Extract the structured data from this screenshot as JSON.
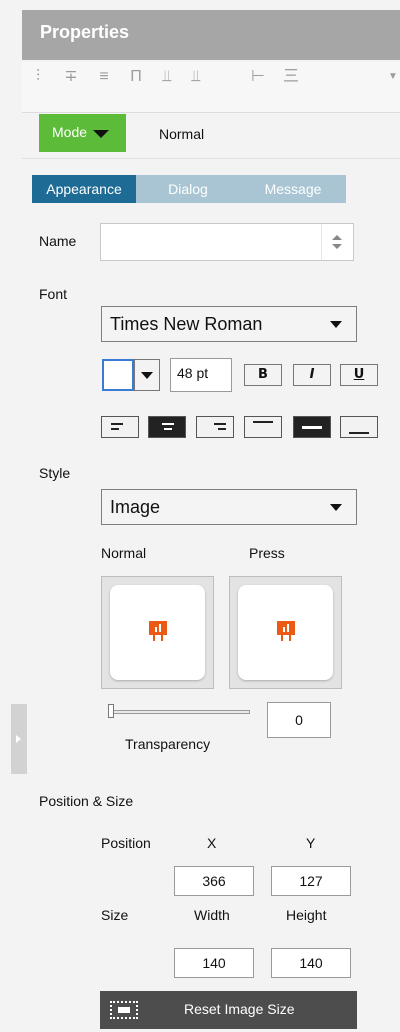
{
  "header": {
    "title": "Properties"
  },
  "toolbar": {
    "icons": [
      "align-left-icon",
      "align-center-icon",
      "align-right-icon",
      "align-top-icon",
      "align-middle-icon",
      "align-bottom-icon",
      "distribute-horizontal-icon",
      "distribute-vertical-icon",
      "more-icon"
    ]
  },
  "mode": {
    "label": "Mode",
    "value": "Normal"
  },
  "tabs": [
    "Appearance",
    "Dialog",
    "Message"
  ],
  "appearance": {
    "name_label": "Name",
    "name_value": "",
    "font_label": "Font",
    "font_family": "Times New Roman",
    "font_size": "48 pt",
    "bold": "B",
    "italic": "I",
    "underline": "U",
    "style_label": "Style",
    "style_value": "Image",
    "normal_label": "Normal",
    "press_label": "Press",
    "transparency_label": "Transparency",
    "transparency_value": "0"
  },
  "position_size": {
    "section_label": "Position & Size",
    "position_label": "Position",
    "x_label": "X",
    "y_label": "Y",
    "x": "366",
    "y": "127",
    "size_label": "Size",
    "width_label": "Width",
    "height_label": "Height",
    "width": "140",
    "height": "140",
    "reset_label": "Reset Image Size"
  },
  "colors": {
    "header_bg": "#a6a6a6",
    "mode_green": "#5cbc3a",
    "tab_active": "#1e6b95",
    "tab_inactive": "#a9c5d4",
    "image_icon": "#ea5a14",
    "reset_bg": "#4d4d4d"
  }
}
